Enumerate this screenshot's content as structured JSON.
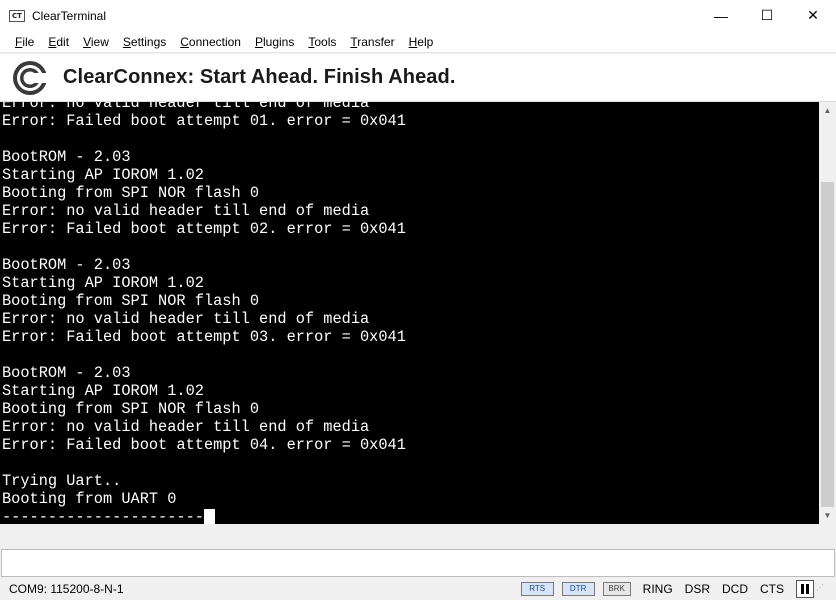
{
  "window": {
    "icon_text": "CT",
    "title": "ClearTerminal",
    "controls": {
      "minimize": "—",
      "maximize": "☐",
      "close": "✕"
    }
  },
  "menu": {
    "items": [
      {
        "label": "File"
      },
      {
        "label": "Edit"
      },
      {
        "label": "View"
      },
      {
        "label": "Settings"
      },
      {
        "label": "Connection"
      },
      {
        "label": "Plugins"
      },
      {
        "label": "Tools"
      },
      {
        "label": "Transfer"
      },
      {
        "label": "Help"
      }
    ]
  },
  "banner": {
    "logo": "clearconnex-logo",
    "text": "ClearConnex: Start Ahead. Finish Ahead."
  },
  "terminal": {
    "lines": [
      "Error: no valid header till end of media",
      "Error: Failed boot attempt 01. error = 0x041",
      "",
      "BootROM - 2.03",
      "Starting AP IOROM 1.02",
      "Booting from SPI NOR flash 0",
      "Error: no valid header till end of media",
      "Error: Failed boot attempt 02. error = 0x041",
      "",
      "BootROM - 2.03",
      "Starting AP IOROM 1.02",
      "Booting from SPI NOR flash 0",
      "Error: no valid header till end of media",
      "Error: Failed boot attempt 03. error = 0x041",
      "",
      "BootROM - 2.03",
      "Starting AP IOROM 1.02",
      "Booting from SPI NOR flash 0",
      "Error: no valid header till end of media",
      "Error: Failed boot attempt 04. error = 0x041",
      "",
      "Trying Uart..",
      "Booting from UART 0",
      "----------------------"
    ],
    "foreground": "#ffffff",
    "background": "#000000"
  },
  "scrollbar": {
    "up_icon": "▲",
    "down_icon": "▼"
  },
  "input": {
    "value": "",
    "placeholder": ""
  },
  "status": {
    "port": "COM9: 115200-8-N-1",
    "buttons": [
      {
        "label": "RTS"
      },
      {
        "label": "DTR"
      },
      {
        "label": "BRK"
      }
    ],
    "signals": [
      {
        "label": "RING"
      },
      {
        "label": "DSR"
      },
      {
        "label": "DCD"
      },
      {
        "label": "CTS"
      }
    ],
    "pause_icon": "pause-icon"
  }
}
